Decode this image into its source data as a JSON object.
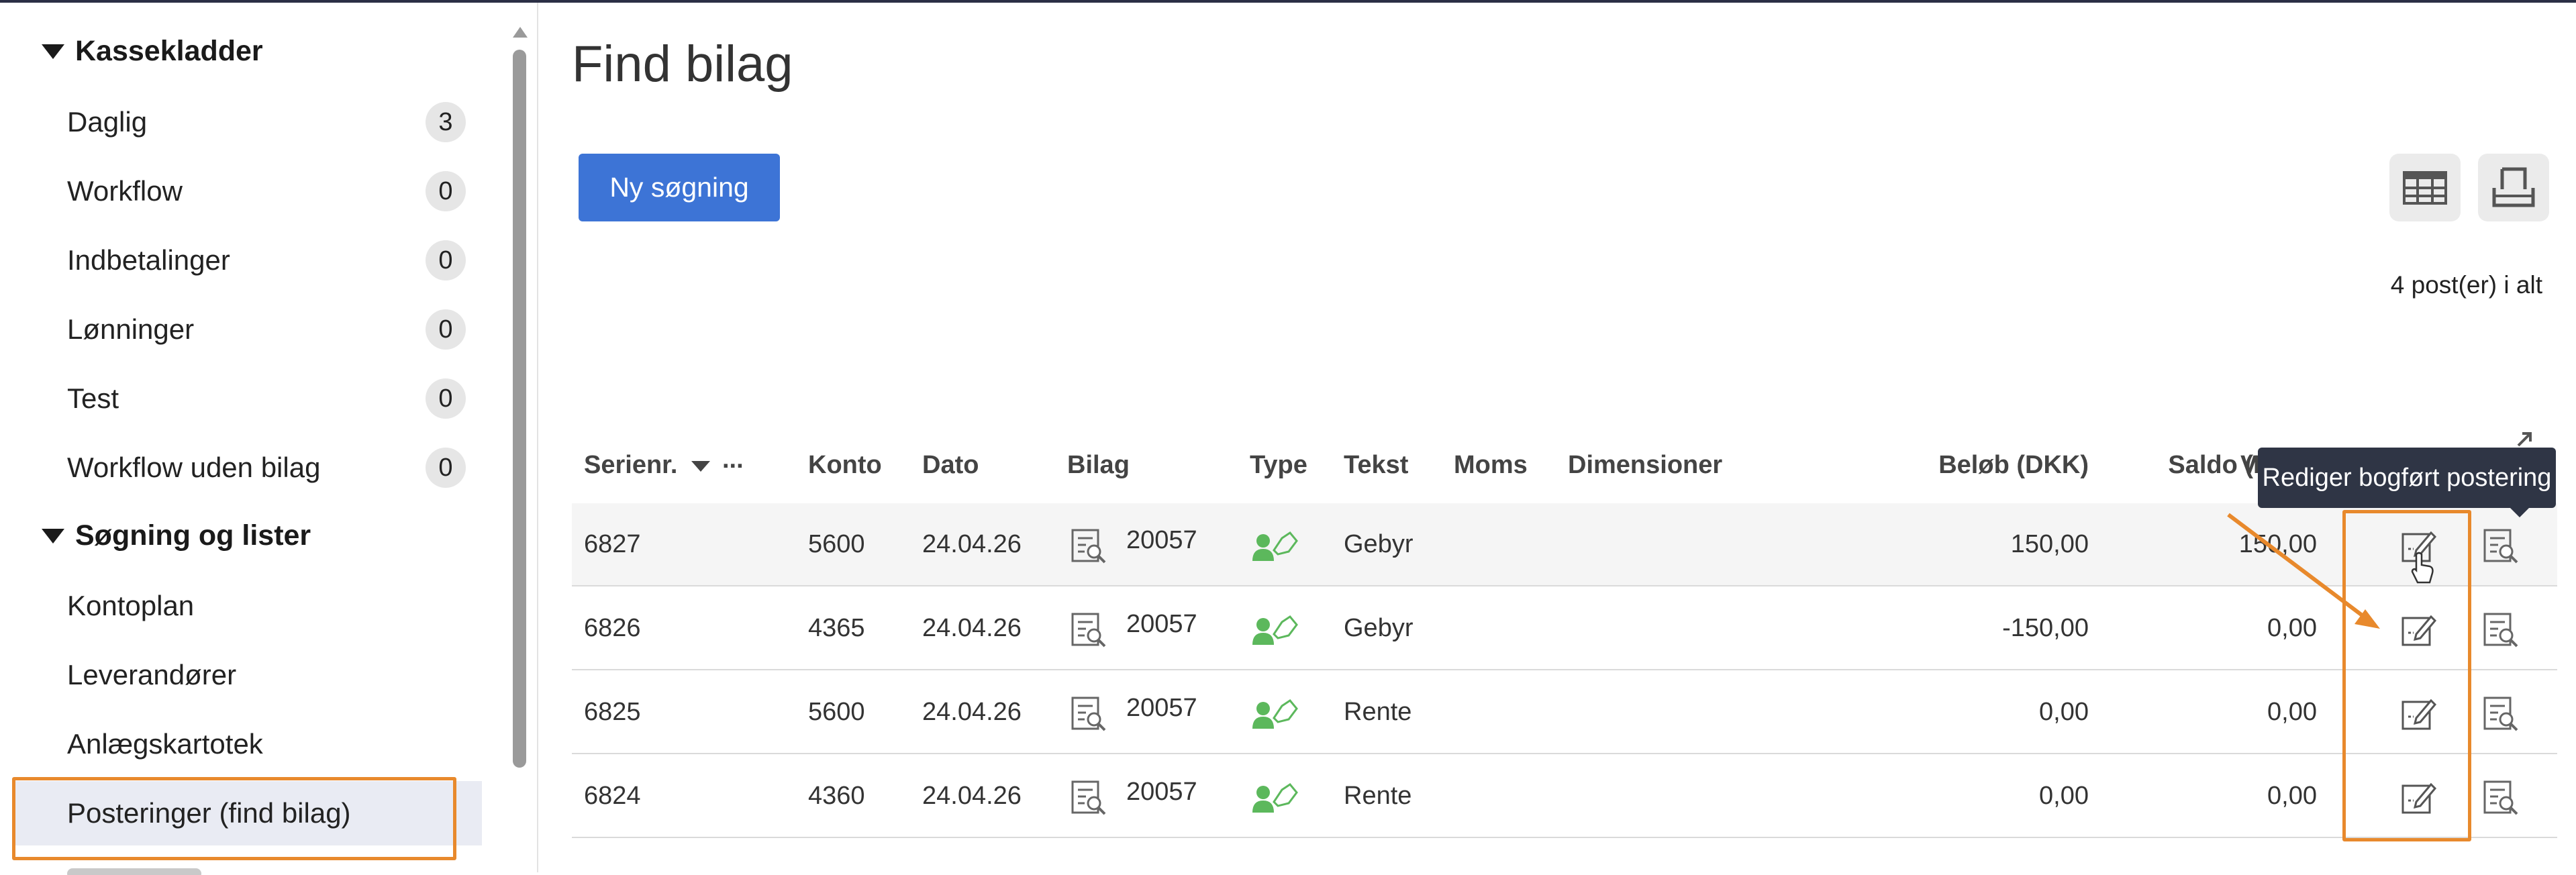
{
  "sidebar": {
    "sections": [
      {
        "label": "Kassekladder"
      },
      {
        "label": "Søgning og lister"
      }
    ],
    "kassekladder_items": [
      {
        "label": "Daglig",
        "count": "3"
      },
      {
        "label": "Workflow",
        "count": "0"
      },
      {
        "label": "Indbetalinger",
        "count": "0"
      },
      {
        "label": "Lønninger",
        "count": "0"
      },
      {
        "label": "Test",
        "count": "0"
      },
      {
        "label": "Workflow uden bilag",
        "count": "0"
      }
    ],
    "search_items": [
      {
        "label": "Kontoplan"
      },
      {
        "label": "Leverandører"
      },
      {
        "label": "Anlægskartotek"
      },
      {
        "label": "Posteringer (find bilag)",
        "active": true
      }
    ]
  },
  "main": {
    "title": "Find bilag",
    "new_search_button": "Ny søgning",
    "toolbar_icons": [
      "table-view-icon",
      "print-icon"
    ],
    "record_count": "4 post(er) i alt",
    "tooltip": "Rediger bogført postering",
    "columns": {
      "serial": "Serienr.",
      "more": "...",
      "account": "Konto",
      "date": "Dato",
      "voucher": "Bilag",
      "type": "Type",
      "text": "Tekst",
      "vat": "Moms",
      "dimensions": "Dimensioner",
      "amount": "Beløb (DKK)",
      "balance": "Saldo (DKK)",
      "partial": "V"
    },
    "rows": [
      {
        "serial": "6827",
        "account": "5600",
        "date": "24.04.26",
        "voucher": "20057",
        "text": "Gebyr",
        "amount": "150,00",
        "balance": "150,00"
      },
      {
        "serial": "6826",
        "account": "4365",
        "date": "24.04.26",
        "voucher": "20057",
        "text": "Gebyr",
        "amount": "-150,00",
        "balance": "0,00"
      },
      {
        "serial": "6825",
        "account": "5600",
        "date": "24.04.26",
        "voucher": "20057",
        "text": "Rente",
        "amount": "0,00",
        "balance": "0,00"
      },
      {
        "serial": "6824",
        "account": "4360",
        "date": "24.04.26",
        "voucher": "20057",
        "text": "Rente",
        "amount": "0,00",
        "balance": "0,00"
      }
    ]
  },
  "colors": {
    "accent": "#3d74d6",
    "highlight_frame": "#e8892c",
    "type_icon": "#5cb85c",
    "tooltip_bg": "#2f3545"
  }
}
